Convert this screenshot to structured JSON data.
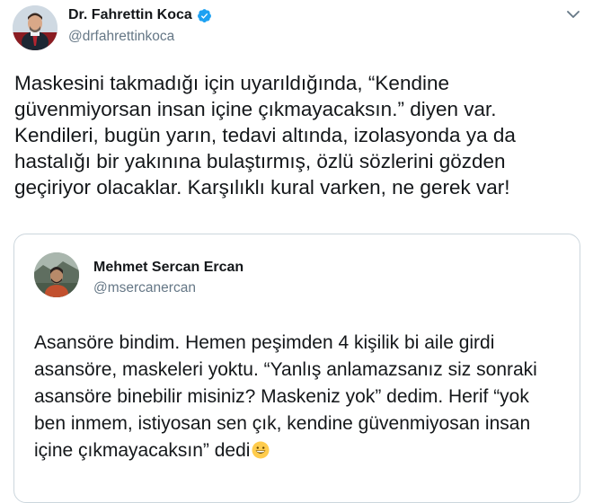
{
  "author": {
    "name": "Dr. Fahrettin Koca",
    "handle": "@drfahrettinkoca",
    "avatar_icon": "profile-photo",
    "verified_icon": "verified-badge-icon"
  },
  "tweet": {
    "lines": [
      "Maskesini takmadığı için uyarıldığında, “Kendine",
      "güvenmiyorsan insan içine çıkmayacaksın.” diyen var.",
      "Kendileri, bugün yarın, tedavi altında, izolasyonda ya da",
      "hastalığı bir yakınına bulaştırmış, özlü sözlerini gözden",
      "geçiriyor olacaklar. Karşılıklı kural varken, ne gerek var!"
    ]
  },
  "quoted": {
    "name": "Mehmet Sercan Ercan",
    "handle": "@msercanercan",
    "lines": [
      "Asansöre bindim. Hemen peşimden 4 kişilik bi aile girdi",
      "asansöre, maskeleri yoktu. “Yanlış anlamazsanız siz sonraki",
      "asansöre binebilir misiniz? Maskeniz yok” dedim. Herif “yok",
      "ben inmem, istiyosan sen çık, kendine güvenmiyosan insan",
      "içine çıkmayacaksın” dedi"
    ],
    "emoji_icon": "grinning-face-emoji"
  },
  "colors": {
    "verified": "#1da1f2",
    "handle": "#657786",
    "border": "#ccd6dd",
    "text": "#14171a"
  }
}
